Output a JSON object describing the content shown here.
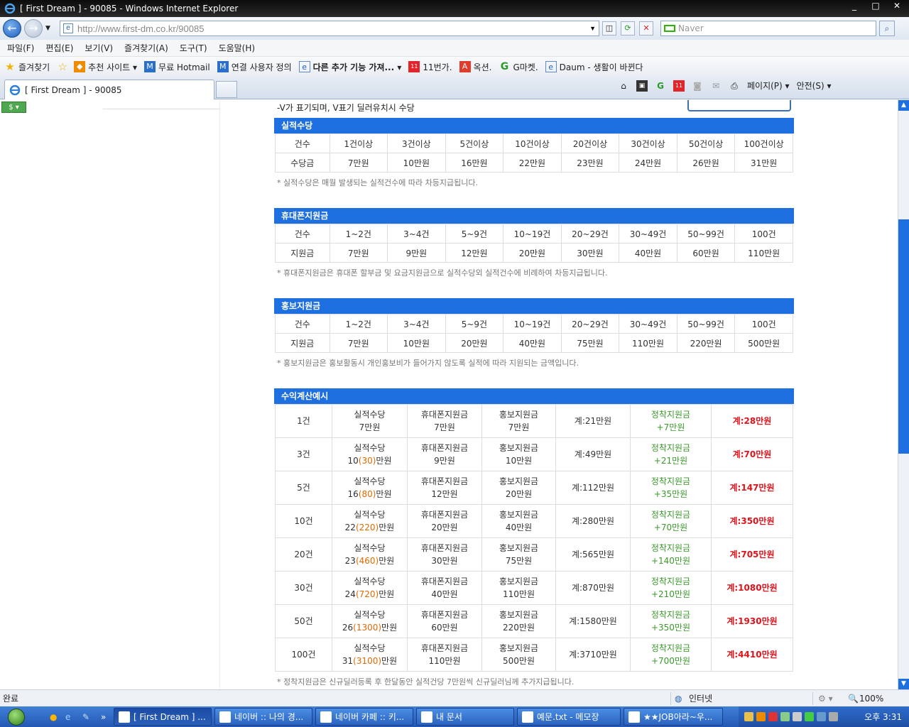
{
  "window": {
    "title": "[ First Dream ] - 90085 - Windows Internet Explorer",
    "controls": [
      "_",
      "□",
      "✕"
    ]
  },
  "address": {
    "url": "http://www.first-dm.co.kr/90085",
    "search_placeholder": "Naver"
  },
  "menu": [
    "파일(F)",
    "편집(E)",
    "보기(V)",
    "즐겨찾기(A)",
    "도구(T)",
    "도움말(H)"
  ],
  "favorites": {
    "label": "즐겨찾기",
    "items": [
      "추천 사이트 ▾",
      "무료 Hotmail",
      "연결 사용자 정의",
      "다른 추가 기능 가져... ▾",
      "11번가.",
      "옥션.",
      "G마켓.",
      "Daum - 생활이 바뀐다"
    ]
  },
  "tab": {
    "label": "[ First Dream ] - 90085"
  },
  "commands": {
    "page": "페이지(P) ▾",
    "safety": "안전(S) ▾"
  },
  "page": {
    "top_note": "-V가 표기되며, V표기 딜러유치시 수당",
    "sections": [
      {
        "title": "실적수당",
        "rows": [
          [
            "건수",
            "1건이상",
            "3건이상",
            "5건이상",
            "10건이상",
            "20건이상",
            "30건이상",
            "50건이상",
            "100건이상"
          ],
          [
            "수당금",
            "7만원",
            "10만원",
            "16만원",
            "22만원",
            "23만원",
            "24만원",
            "26만원",
            "31만원"
          ]
        ],
        "note": "* 실적수당은 매월 발생되는 실적건수에 따라 차등지급됩니다."
      },
      {
        "title": "휴대폰지원금",
        "rows": [
          [
            "건수",
            "1~2건",
            "3~4건",
            "5~9건",
            "10~19건",
            "20~29건",
            "30~49건",
            "50~99건",
            "100건"
          ],
          [
            "지원금",
            "7만원",
            "9만원",
            "12만원",
            "20만원",
            "30만원",
            "40만원",
            "60만원",
            "110만원"
          ]
        ],
        "note": "* 휴대폰지원금은 휴대폰 할부금 및 요금지원금으로 실적수당외 실적건수에 비례하여 차등지급됩니다."
      },
      {
        "title": "홍보지원금",
        "rows": [
          [
            "건수",
            "1~2건",
            "3~4건",
            "5~9건",
            "10~19건",
            "20~29건",
            "30~49건",
            "50~99건",
            "100건"
          ],
          [
            "지원금",
            "7만원",
            "10만원",
            "20만원",
            "40만원",
            "75만원",
            "110만원",
            "220만원",
            "500만원"
          ]
        ],
        "note": "* 홍보지원금은 홍보활동시 개인홍보비가 들어가지 않도록 실적에 따라 지원되는 금액입니다."
      }
    ],
    "calc": {
      "title": "수익계산예시",
      "label_perf": "실적수당",
      "label_phone": "휴대폰지원금",
      "label_promo": "홍보지원금",
      "label_settle": "정착지원금",
      "rows": [
        {
          "count": "1건",
          "perf_pre": "7만원",
          "perf_paren": "",
          "perf_post": "",
          "phone": "7만원",
          "promo": "7만원",
          "sub": "계:21만원",
          "settle": "+7만원",
          "total": "계:28만원"
        },
        {
          "count": "3건",
          "perf_pre": "10",
          "perf_paren": "(30)",
          "perf_post": "만원",
          "phone": "9만원",
          "promo": "10만원",
          "sub": "계:49만원",
          "settle": "+21만원",
          "total": "계:70만원"
        },
        {
          "count": "5건",
          "perf_pre": "16",
          "perf_paren": "(80)",
          "perf_post": "만원",
          "phone": "12만원",
          "promo": "20만원",
          "sub": "계:112만원",
          "settle": "+35만원",
          "total": "계:147만원"
        },
        {
          "count": "10건",
          "perf_pre": "22",
          "perf_paren": "(220)",
          "perf_post": "만원",
          "phone": "20만원",
          "promo": "40만원",
          "sub": "계:280만원",
          "settle": "+70만원",
          "total": "계:350만원"
        },
        {
          "count": "20건",
          "perf_pre": "23",
          "perf_paren": "(460)",
          "perf_post": "만원",
          "phone": "30만원",
          "promo": "75만원",
          "sub": "계:565만원",
          "settle": "+140만원",
          "total": "계:705만원"
        },
        {
          "count": "30건",
          "perf_pre": "24",
          "perf_paren": "(720)",
          "perf_post": "만원",
          "phone": "40만원",
          "promo": "110만원",
          "sub": "계:870만원",
          "settle": "+210만원",
          "total": "계:1080만원"
        },
        {
          "count": "50건",
          "perf_pre": "26",
          "perf_paren": "(1300)",
          "perf_post": "만원",
          "phone": "60만원",
          "promo": "220만원",
          "sub": "계:1580만원",
          "settle": "+350만원",
          "total": "계:1930만원"
        },
        {
          "count": "100건",
          "perf_pre": "31",
          "perf_paren": "(3100)",
          "perf_post": "만원",
          "phone": "110만원",
          "promo": "500만원",
          "sub": "계:3710만원",
          "settle": "+700만원",
          "total": "계:4410만원"
        }
      ],
      "note": "* 정착지원금은 신규딜러등록 후 한달동안 실적건당 7만원씩 신규딜러님께 추가지급됩니다."
    }
  },
  "status": {
    "left": "완료",
    "zone": "인터넷",
    "zoom": "100%"
  },
  "taskbar": {
    "items": [
      "[ First Dream ] ...",
      "네이버 :: 나의 경...",
      "네이버 카페 :: 키...",
      "내 문서",
      "예문.txt - 메모장",
      "★★JOB아라~우..."
    ],
    "clock": "오후 3:31"
  },
  "colors": {
    "section_header": "#1e6fe0",
    "total": "#e0121b",
    "settle": "#3a9a2a",
    "paren": "#e06a00"
  }
}
